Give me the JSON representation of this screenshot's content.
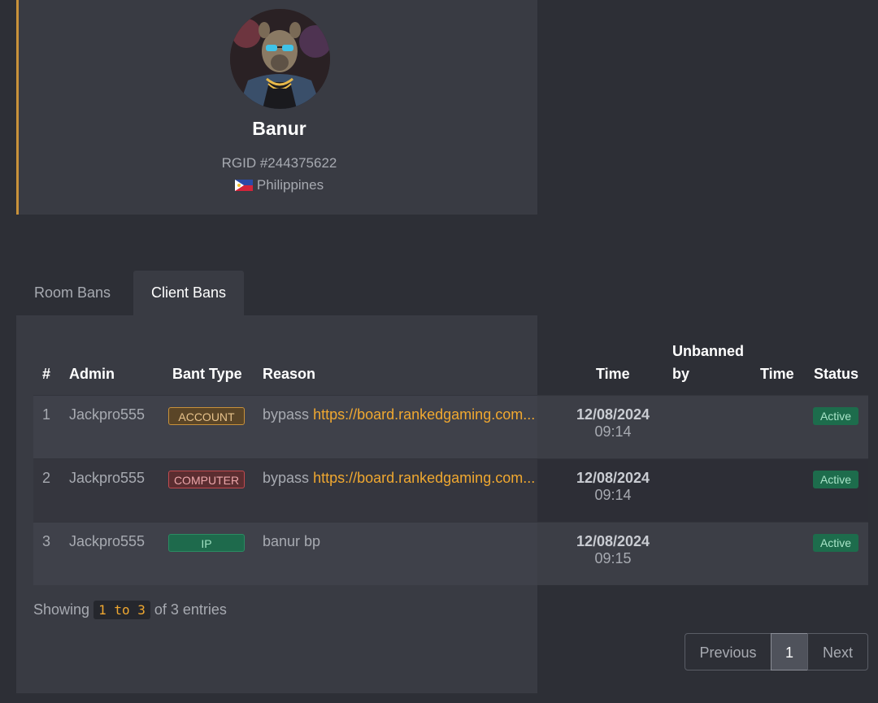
{
  "profile": {
    "name": "Banur",
    "rgid": "RGID #244375622",
    "country": "Philippines",
    "avatar_icon": "hyena-avatar"
  },
  "tabs": [
    {
      "label": "Room Bans",
      "active": false
    },
    {
      "label": "Client Bans",
      "active": true
    }
  ],
  "table": {
    "columns": [
      "#",
      "Admin",
      "Bant Type",
      "Reason",
      "Time",
      "Unbanned",
      "by",
      "Time",
      "Status"
    ],
    "rows": [
      {
        "num": "1",
        "admin": "Jackpro555",
        "type": "ACCOUNT",
        "reason": "bypass",
        "link": "https://board.rankedgaming.com...",
        "date": "12/08/2024",
        "time": "09:14",
        "status": "Active"
      },
      {
        "num": "2",
        "admin": "Jackpro555",
        "type": "COMPUTER",
        "reason": "bypass",
        "link": "https://board.rankedgaming.com...",
        "date": "12/08/2024",
        "time": "09:14",
        "status": "Active"
      },
      {
        "num": "3",
        "admin": "Jackpro555",
        "type": "IP",
        "reason": "banur bp",
        "link": "",
        "date": "12/08/2024",
        "time": "09:15",
        "status": "Active"
      }
    ]
  },
  "footer": {
    "showing_prefix": "Showing",
    "range": "1 to 3",
    "showing_suffix": "of 3 entries"
  },
  "pagination": {
    "previous": "Previous",
    "current": "1",
    "next": "Next"
  },
  "colors": {
    "accent": "#c8913a",
    "link": "#f0a830",
    "active": "#1d6c4c",
    "computer": "#c24a4f"
  }
}
